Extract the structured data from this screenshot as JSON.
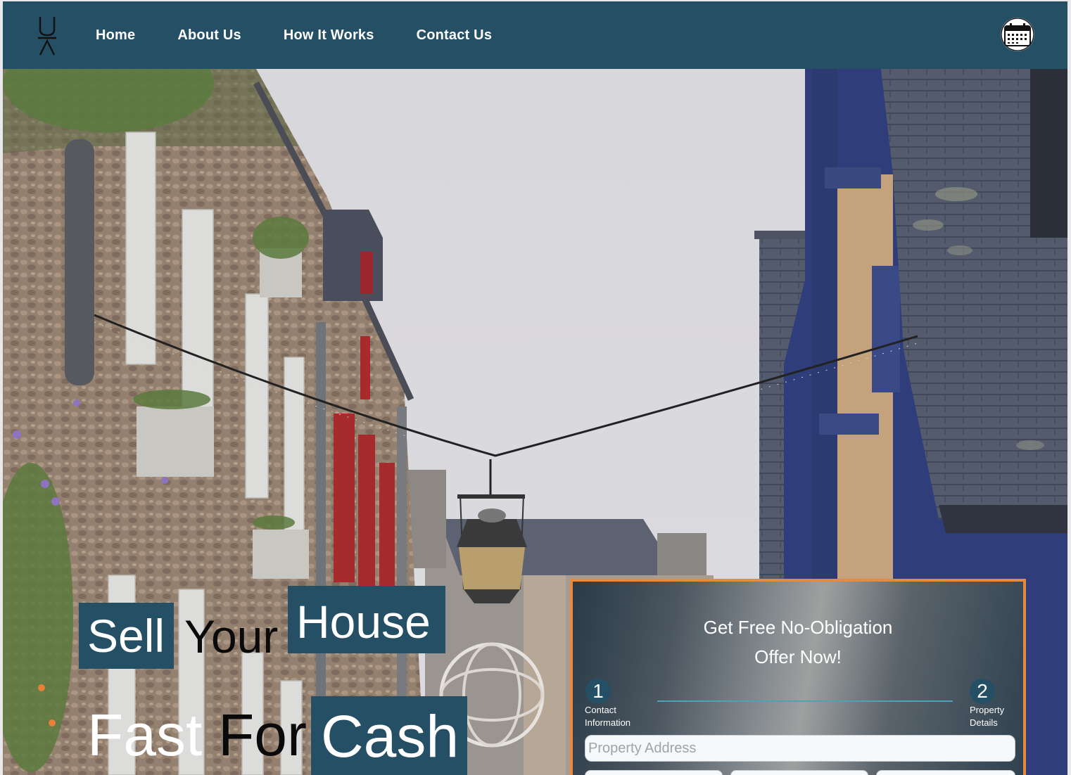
{
  "nav": {
    "logo": "logo-mark",
    "links": [
      {
        "label": "Home"
      },
      {
        "label": "About Us"
      },
      {
        "label": "How It Works"
      },
      {
        "label": "Contact Us"
      }
    ],
    "calendar_icon": "calendar-icon"
  },
  "hero": {
    "headline": {
      "word1": "Sell",
      "word2": "Your",
      "word3": "House",
      "word4": "Fast",
      "word5": "For",
      "word6": "Cash"
    }
  },
  "offer_form": {
    "title_line1": "Get Free No-Obligation",
    "title_line2": "Offer Now!",
    "steps": [
      {
        "number": "1",
        "label_line1": "Contact",
        "label_line2": "Information"
      },
      {
        "number": "2",
        "label_line1": "Property",
        "label_line2": "Details"
      }
    ],
    "address_placeholder": "Property Address"
  },
  "colors": {
    "nav_bg": "#244f65",
    "highlight_box": "#244f65",
    "card_border": "#e88a3c",
    "step_line": "#4ba3b4"
  }
}
